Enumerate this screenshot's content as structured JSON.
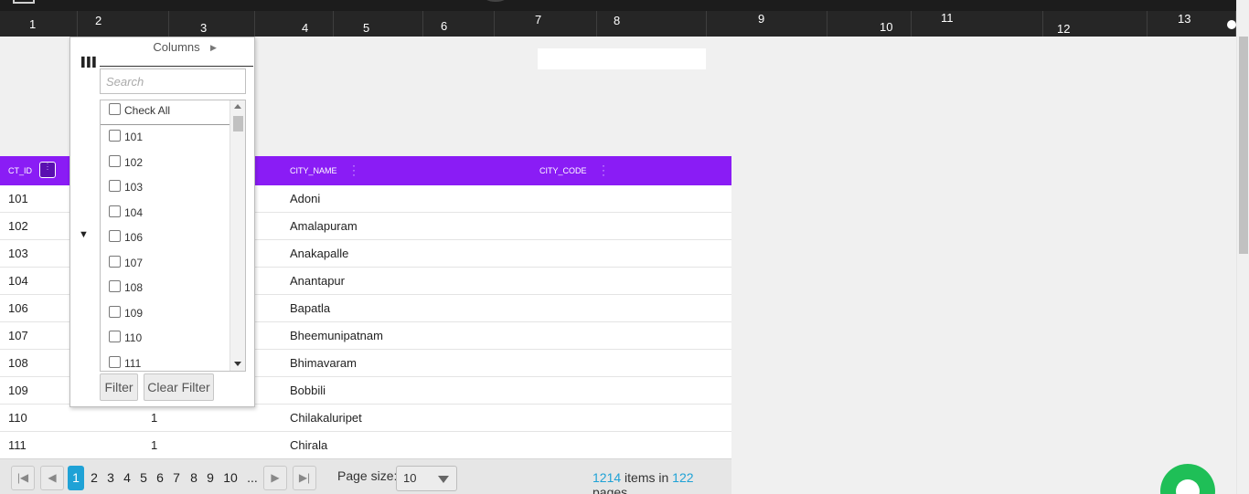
{
  "nav": {
    "tabs": [
      "1",
      "2",
      "3",
      "4",
      "5",
      "6",
      "7",
      "8",
      "9",
      "10",
      "11",
      "12",
      "13"
    ]
  },
  "grid": {
    "headers": {
      "ct_id": "CT_ID",
      "city_name": "CITY_NAME",
      "city_code": "CITY_CODE"
    },
    "rows": [
      {
        "id": "101",
        "col2": "",
        "city": "Adoni"
      },
      {
        "id": "102",
        "col2": "",
        "city": "Amalapuram"
      },
      {
        "id": "103",
        "col2": "",
        "city": "Anakapalle"
      },
      {
        "id": "104",
        "col2": "",
        "city": "Anantapur"
      },
      {
        "id": "106",
        "col2": "",
        "city": "Bapatla"
      },
      {
        "id": "107",
        "col2": "",
        "city": "Bheemunipatnam"
      },
      {
        "id": "108",
        "col2": "",
        "city": "Bhimavaram"
      },
      {
        "id": "109",
        "col2": "",
        "city": "Bobbili"
      },
      {
        "id": "110",
        "col2": "1",
        "city": "Chilakaluripet"
      },
      {
        "id": "111",
        "col2": "1",
        "city": "Chirala"
      }
    ]
  },
  "column_menu": {
    "title": "Columns",
    "search_placeholder": "Search",
    "check_all": "Check All",
    "values": [
      "101",
      "102",
      "103",
      "104",
      "106",
      "107",
      "108",
      "109",
      "110",
      "111"
    ],
    "filter_button": "Filter",
    "clear_filter_button": "Clear Filter"
  },
  "pager": {
    "pages": [
      "1",
      "2",
      "3",
      "4",
      "5",
      "6",
      "7",
      "8",
      "9",
      "10",
      "..."
    ],
    "current": "1",
    "page_size_label": "Page size:",
    "page_size": "10",
    "total_items": "1214",
    "items_in": "items in",
    "total_pages": "122",
    "pages_label": "pages"
  },
  "colors": {
    "header": "#8a1cf5",
    "accent": "#1fa2d6",
    "chat": "#1fbf57"
  }
}
